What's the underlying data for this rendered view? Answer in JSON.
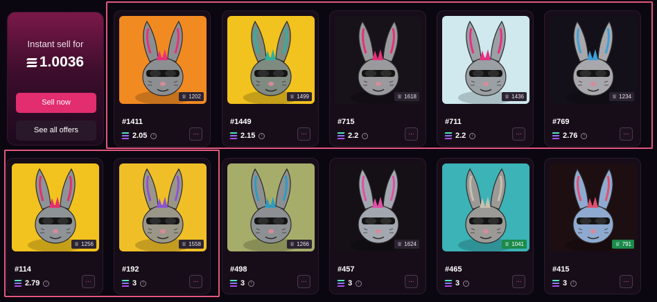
{
  "sell_panel": {
    "title": "Instant sell for",
    "price": "1.0036",
    "sell_button": "Sell now",
    "offers_button": "See all offers"
  },
  "colors": {
    "accent": "#e22d6f",
    "selection": "#e2577d",
    "card_bg": "#170d19",
    "rank_green": "#1b8a4a"
  },
  "icons": {
    "currency": "solana-icon",
    "rank": "trophy-icon",
    "info": "info-icon",
    "more": "ellipsis-icon"
  },
  "cards": [
    {
      "name": "#1411",
      "price": "2.05",
      "rank": "1202",
      "rank_green": false,
      "more": "...",
      "bg": "#f28a22",
      "fur": "#8c8f92",
      "accent": "#e9307a"
    },
    {
      "name": "#1449",
      "price": "2.15",
      "rank": "1499",
      "rank_green": false,
      "more": "...",
      "bg": "#f2c21e",
      "fur": "#7f8a80",
      "accent": "#2fb0a0"
    },
    {
      "name": "#715",
      "price": "2.2",
      "rank": "1618",
      "rank_green": false,
      "more": "...",
      "bg": "#17111a",
      "fur": "#9a9a9e",
      "accent": "#e7307a"
    },
    {
      "name": "#711",
      "price": "2.2",
      "rank": "1436",
      "rank_green": false,
      "more": "...",
      "bg": "#cfe9ee",
      "fur": "#9aa0a4",
      "accent": "#e63083"
    },
    {
      "name": "#769",
      "price": "2.76",
      "rank": "1234",
      "rank_green": false,
      "more": "...",
      "bg": "#141019",
      "fur": "#a8a8ac",
      "accent": "#3fa0d8"
    },
    {
      "name": "#114",
      "price": "2.79",
      "rank": "1256",
      "rank_green": false,
      "more": "...",
      "bg": "#f2c21e",
      "fur": "#8e9398",
      "accent": "#e3306d"
    },
    {
      "name": "#192",
      "price": "3",
      "rank": "1558",
      "rank_green": false,
      "more": "...",
      "bg": "#f0bf28",
      "fur": "#9a9688",
      "accent": "#8a54d8"
    },
    {
      "name": "#498",
      "price": "3",
      "rank": "1266",
      "rank_green": false,
      "more": "...",
      "bg": "#a6ad6a",
      "fur": "#8c9092",
      "accent": "#2c9cc4"
    },
    {
      "name": "#457",
      "price": "3",
      "rank": "1624",
      "rank_green": false,
      "more": "...",
      "bg": "#141016",
      "fur": "#a3a8b0",
      "accent": "#e34fa5"
    },
    {
      "name": "#465",
      "price": "3",
      "rank": "1041",
      "rank_green": true,
      "more": "...",
      "bg": "#3bb3b7",
      "fur": "#9c9a96",
      "accent": "#c8c0b0"
    },
    {
      "name": "#415",
      "price": "3",
      "rank": "791",
      "rank_green": true,
      "more": "...",
      "bg": "#1d0e12",
      "fur": "#8faad0",
      "accent": "#e05070"
    }
  ]
}
